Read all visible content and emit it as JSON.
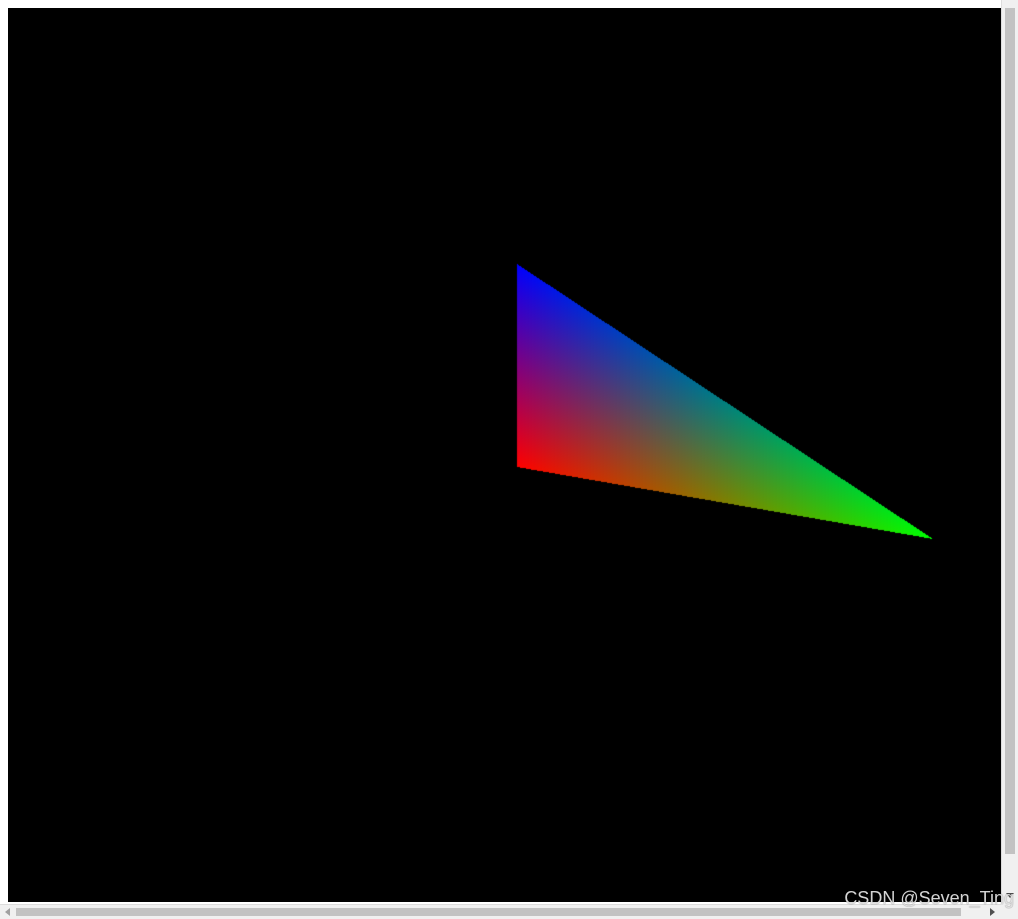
{
  "scene": {
    "background": "#000000",
    "vertex_colors": {
      "top": "#0000ff",
      "right": "#00ff00",
      "bottom_left": "#ff0000"
    }
  },
  "watermark": {
    "text": "CSDN @Seven_Ting"
  }
}
